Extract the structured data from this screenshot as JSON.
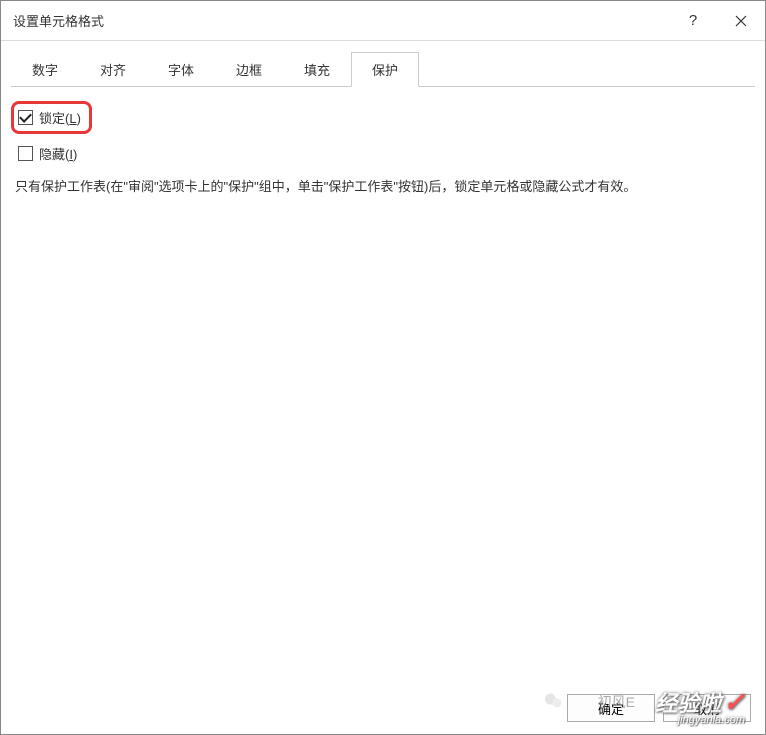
{
  "titleBar": {
    "title": "设置单元格格式"
  },
  "tabs": {
    "items": [
      {
        "label": "数字"
      },
      {
        "label": "对齐"
      },
      {
        "label": "字体"
      },
      {
        "label": "边框"
      },
      {
        "label": "填充"
      },
      {
        "label": "保护"
      }
    ],
    "activeIndex": 5
  },
  "protection": {
    "lockedLabel": "锁定(",
    "lockedKey": "L",
    "lockedClose": ")",
    "lockedChecked": true,
    "hiddenLabel": "隐藏(",
    "hiddenKey": "I",
    "hiddenClose": ")",
    "hiddenChecked": false,
    "description": "只有保护工作表(在\"审阅\"选项卡上的\"保护\"组中，单击\"保护工作表\"按钮)后，锁定单元格或隐藏公式才有效。"
  },
  "footer": {
    "ok": "确定",
    "cancel": "取消"
  },
  "watermark": {
    "extra": "初风E",
    "main": "经验啦",
    "sub": "jingyanla.com"
  }
}
